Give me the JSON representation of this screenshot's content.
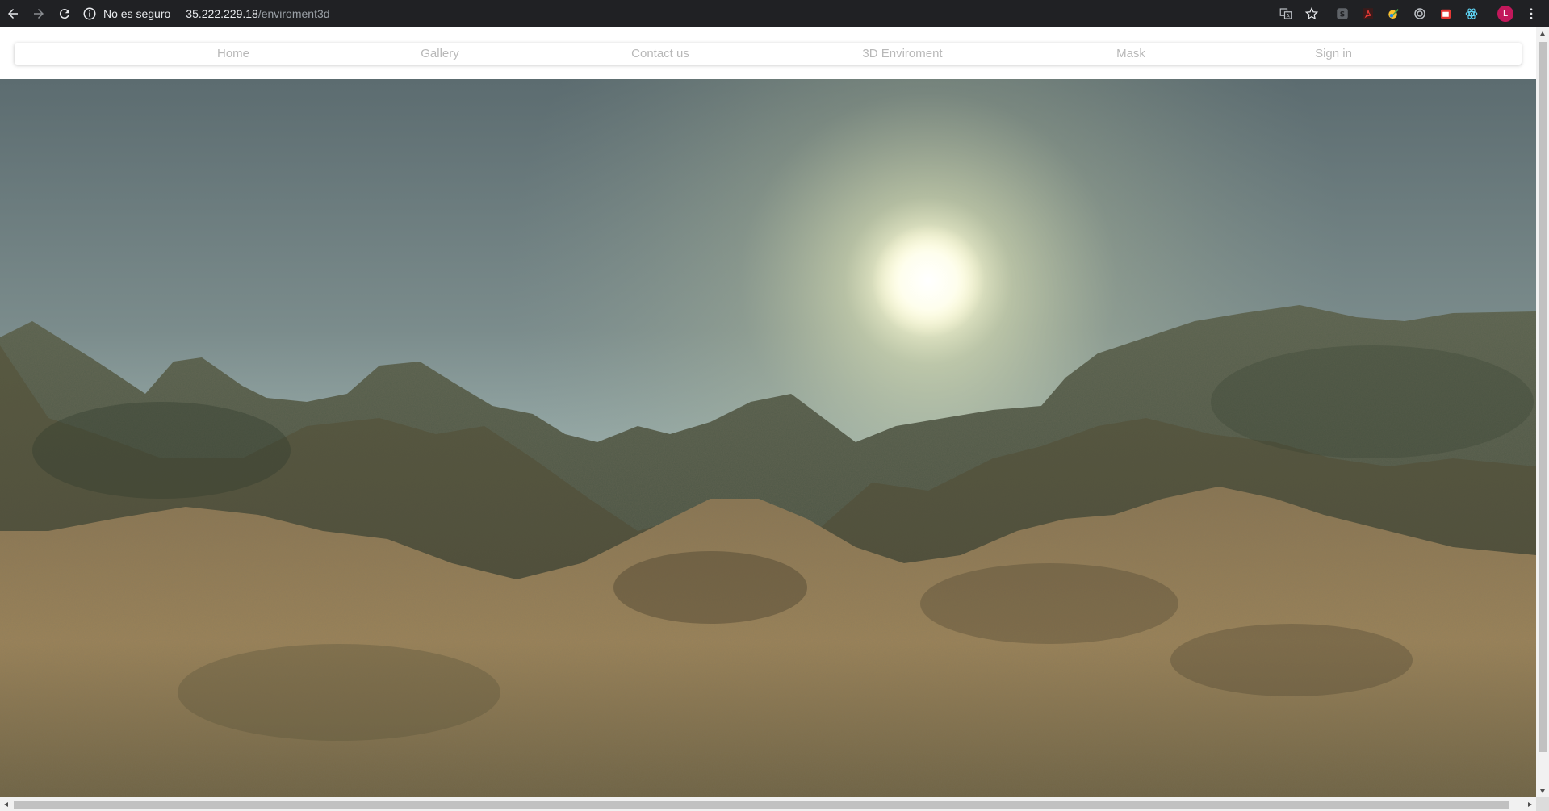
{
  "browser": {
    "security_text": "No es seguro",
    "url_host": "35.222.229.18",
    "url_path": "/enviroment3d",
    "avatar_letter": "L",
    "icons": [
      "back-icon",
      "forward-icon",
      "reload-icon",
      "info-icon",
      "translate-icon",
      "star-icon",
      "skype-icon",
      "pdf-icon",
      "color-picker-icon",
      "target-icon",
      "extension-icon",
      "react-icon",
      "menu-icon"
    ]
  },
  "navbar": {
    "items": [
      {
        "label": "Home"
      },
      {
        "label": "Gallery"
      },
      {
        "label": "Contact us"
      },
      {
        "label": "3D Enviroment"
      },
      {
        "label": "Mask"
      },
      {
        "label": "Sign in"
      }
    ]
  },
  "scene": {
    "description_colors": {
      "sky_top": "#5e6e72",
      "sky_horizon": "#b8c9c0",
      "sun": "#fffbe0",
      "mountain_dark": "#3e4a3c",
      "mountain_mid": "#5f5a44",
      "foreground": "#9a8057"
    }
  }
}
